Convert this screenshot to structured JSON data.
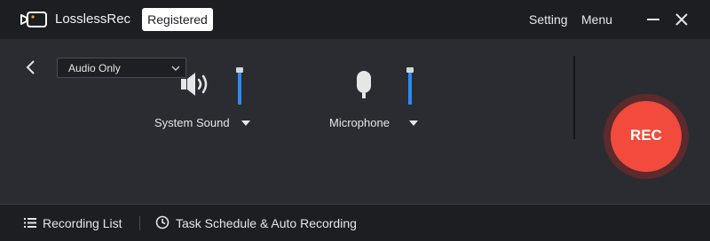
{
  "titlebar": {
    "app_name": "LosslessRec",
    "badge": "Registered",
    "setting_label": "Setting",
    "menu_label": "Menu",
    "icons": {
      "logo": "camera-logo-icon",
      "minimize": "minimize-icon",
      "close": "close-icon"
    }
  },
  "toolbar": {
    "back_icon": "chevron-left-icon",
    "mode_select": {
      "value": "Audio Only",
      "icon": "chevron-down-icon"
    }
  },
  "sources": {
    "system_sound": {
      "label": "System Sound",
      "icon": "speaker-icon",
      "volume": 1.0
    },
    "microphone": {
      "label": "Microphone",
      "icon": "microphone-icon",
      "volume": 1.0
    }
  },
  "rec_button": {
    "label": "REC",
    "color": "#f24a3d"
  },
  "bottombar": {
    "recording_list_label": "Recording List",
    "recording_list_icon": "list-icon",
    "schedule_label": "Task Schedule & Auto Recording",
    "schedule_icon": "clock-icon"
  },
  "colors": {
    "accent": "#2a8cf0",
    "rec": "#f24a3d",
    "background": "#2b2c31",
    "bar": "#1d1e22"
  }
}
